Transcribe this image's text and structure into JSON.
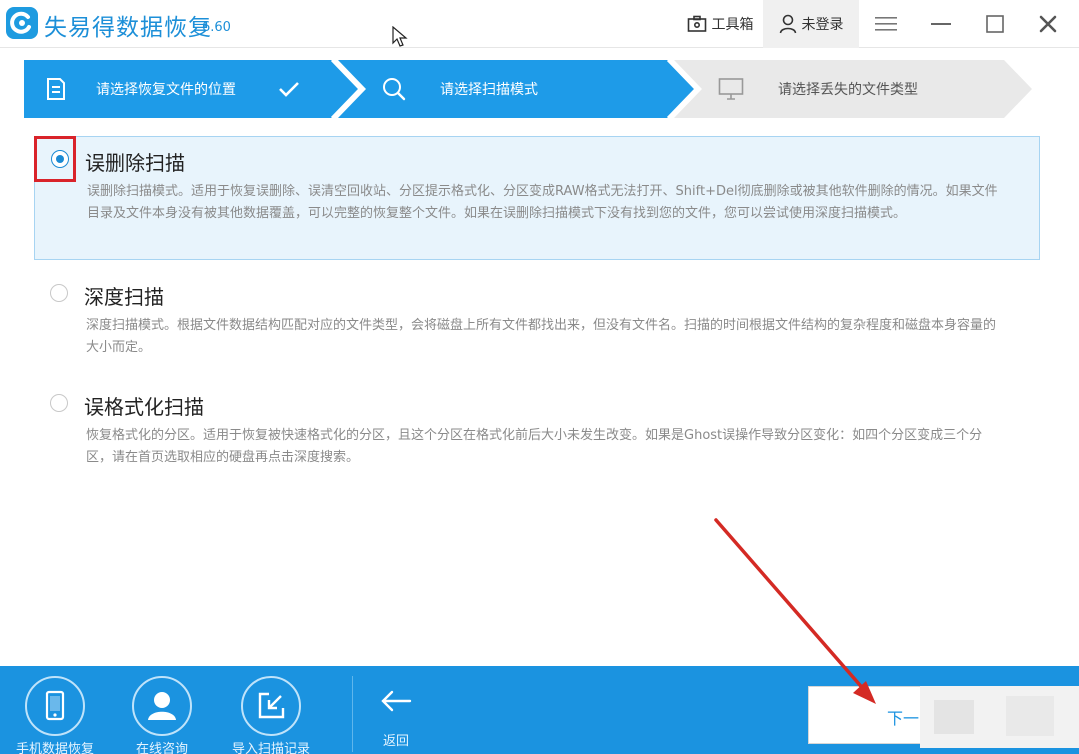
{
  "window": {
    "title": "失易得数据恢复",
    "version": "6.60",
    "toolbox_label": "工具箱",
    "login_label": "未登录"
  },
  "steps": [
    {
      "label": "请选择恢复文件的位置",
      "state": "done"
    },
    {
      "label": "请选择扫描模式",
      "state": "active"
    },
    {
      "label": "请选择丢失的文件类型",
      "state": "pending"
    }
  ],
  "scan_modes": [
    {
      "title": "误删除扫描",
      "description": "误删除扫描模式。适用于恢复误删除、误清空回收站、分区提示格式化、分区变成RAW格式无法打开、Shift+Del彻底删除或被其他软件删除的情况。如果文件目录及文件本身没有被其他数据覆盖，可以完整的恢复整个文件。如果在误删除扫描模式下没有找到您的文件，您可以尝试使用深度扫描模式。",
      "selected": true
    },
    {
      "title": "深度扫描",
      "description": "深度扫描模式。根据文件数据结构匹配对应的文件类型，会将磁盘上所有文件都找出来，但没有文件名。扫描的时间根据文件结构的复杂程度和磁盘本身容量的大小而定。",
      "selected": false
    },
    {
      "title": "误格式化扫描",
      "description": "恢复格式化的分区。适用于恢复被快速格式化的分区，且这个分区在格式化前后大小未发生改变。如果是Ghost误操作导致分区变化：如四个分区变成三个分区，请在首页选取相应的硬盘再点击深度搜索。",
      "selected": false
    }
  ],
  "bottom_bar": {
    "items": [
      {
        "label": "手机数据恢复",
        "icon": "phone-icon"
      },
      {
        "label": "在线咨询",
        "icon": "user-icon"
      },
      {
        "label": "导入扫描记录",
        "icon": "import-icon"
      }
    ],
    "back_label": "返回",
    "next_label": "下一"
  },
  "colors": {
    "accent": "#1b93e0",
    "step_active": "#1e9be8",
    "highlight_red": "#d9232a"
  }
}
